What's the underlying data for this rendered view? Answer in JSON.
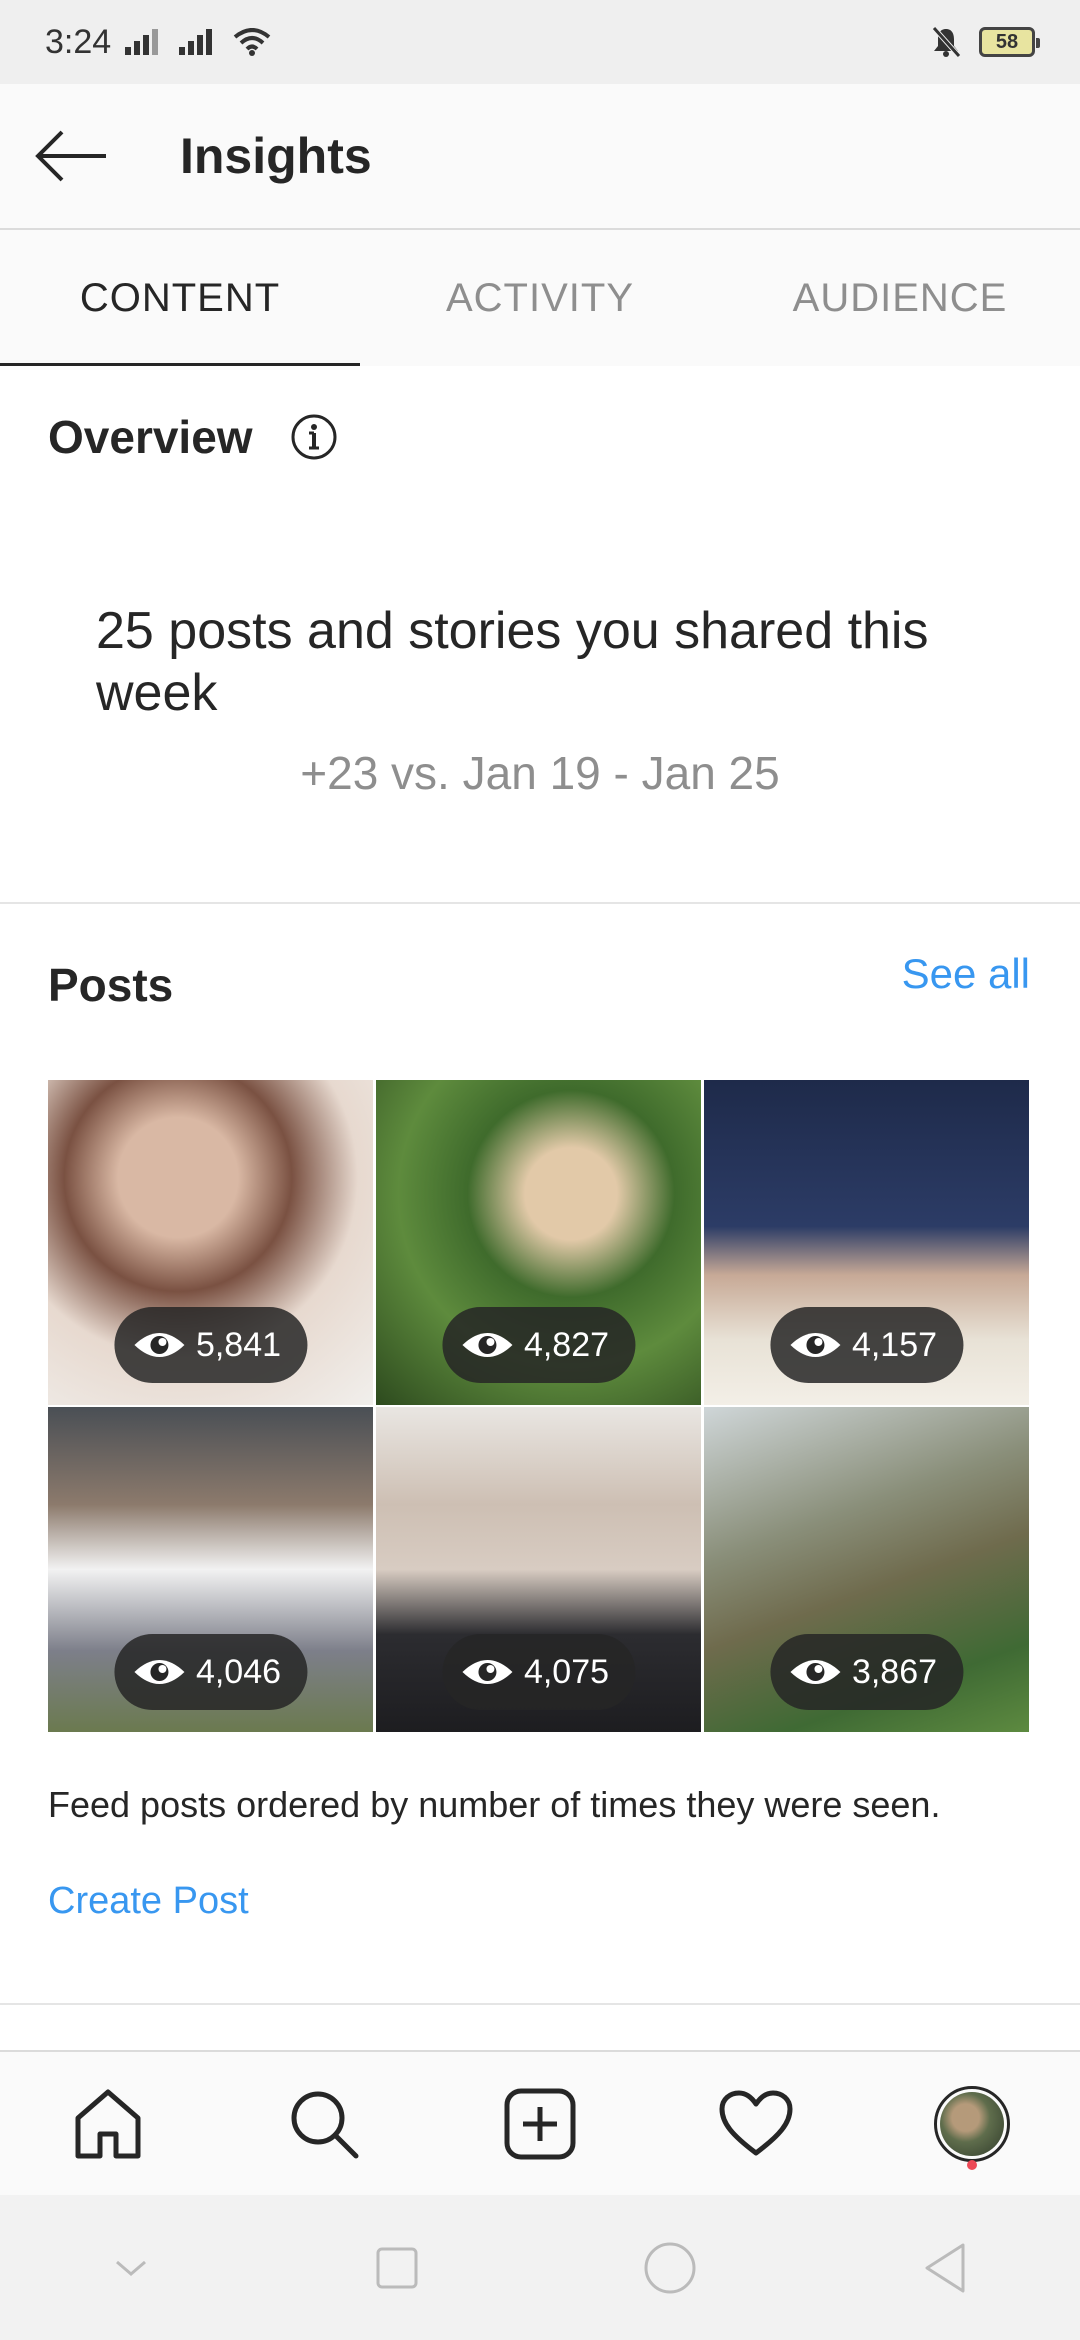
{
  "status_bar": {
    "time": "3:24",
    "battery": "58"
  },
  "header": {
    "title": "Insights"
  },
  "tabs": [
    {
      "label": "CONTENT",
      "active": true
    },
    {
      "label": "ACTIVITY",
      "active": false
    },
    {
      "label": "AUDIENCE",
      "active": false
    }
  ],
  "overview": {
    "title": "Overview",
    "headline": "25 posts and stories you shared this week",
    "comparison": "+23 vs. Jan 19 - Jan 25"
  },
  "posts": {
    "title": "Posts",
    "see_all": "See all",
    "items": [
      {
        "views": "5,841"
      },
      {
        "views": "4,827"
      },
      {
        "views": "4,157"
      },
      {
        "views": "4,046"
      },
      {
        "views": "4,075"
      },
      {
        "views": "3,867"
      }
    ],
    "caption": "Feed posts ordered by number of times they were seen.",
    "create_post": "Create Post"
  },
  "bottom_nav": [
    "home-icon",
    "search-icon",
    "new-post-icon",
    "activity-heart-icon",
    "profile-avatar"
  ],
  "colors": {
    "accent": "#3897f0",
    "text": "#262626",
    "muted": "#8e8e8e",
    "notification": "#ed4956"
  }
}
